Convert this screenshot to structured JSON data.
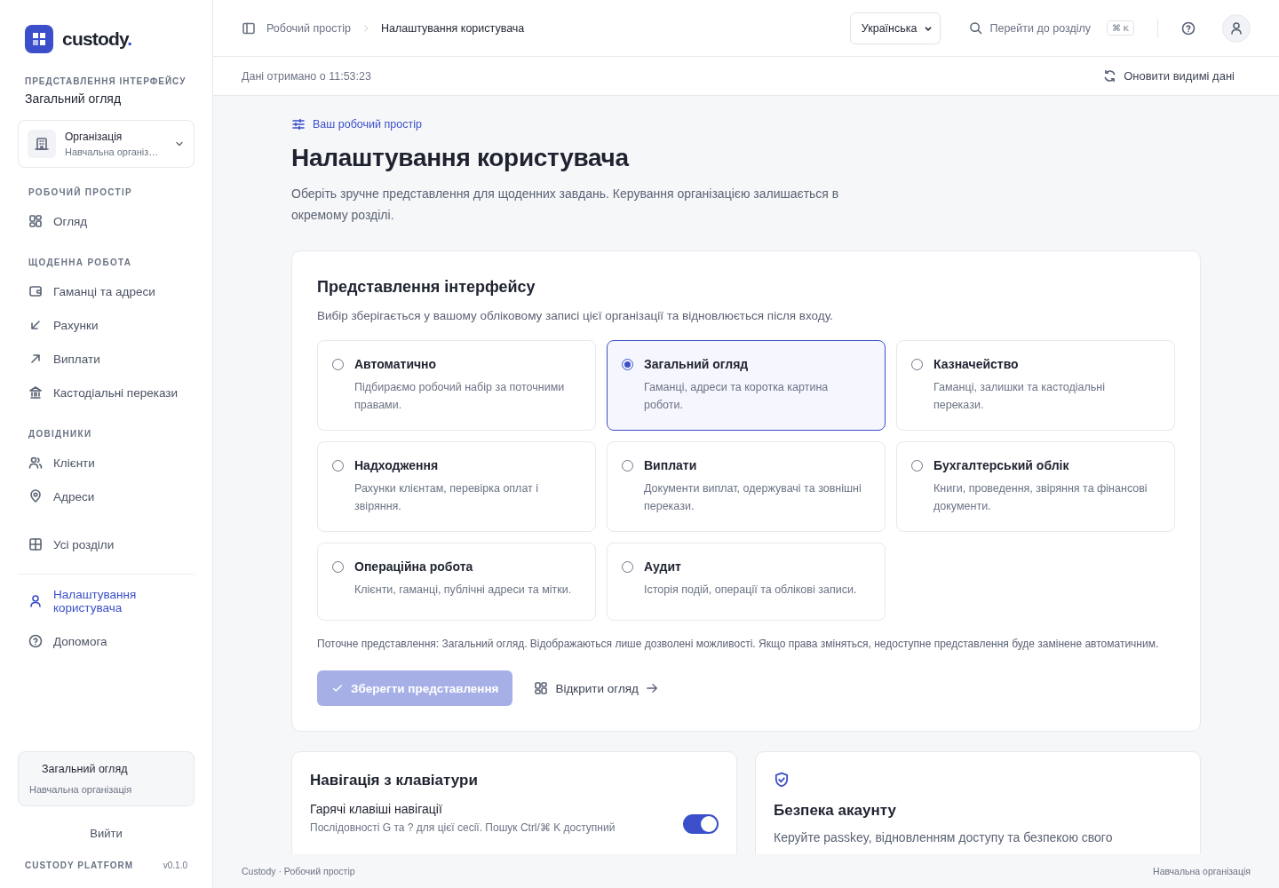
{
  "brand": {
    "name": "custody",
    "mark": "."
  },
  "sidebar": {
    "view_label": "ПРЕДСТАВЛЕННЯ ІНТЕРФЕЙСУ",
    "view_value": "Загальний огляд",
    "org": {
      "title": "Організація",
      "subtitle": "Навчальна організ…"
    },
    "sections": [
      {
        "heading": "РОБОЧИЙ ПРОСТІР",
        "items": [
          {
            "kind": "grid",
            "label": "Огляд",
            "selected": false
          }
        ]
      },
      {
        "heading": "ЩОДЕННА РОБОТА",
        "items": [
          {
            "kind": "wallet",
            "label": "Гаманці та адреси",
            "selected": false
          },
          {
            "kind": "arrow-in",
            "label": "Рахунки",
            "selected": false
          },
          {
            "kind": "arrow-out",
            "label": "Виплати",
            "selected": false
          },
          {
            "kind": "bank",
            "label": "Кастодіальні перекази",
            "selected": false
          }
        ]
      },
      {
        "heading": "ДОВІДНИКИ",
        "items": [
          {
            "kind": "users",
            "label": "Клієнти",
            "selected": false
          },
          {
            "kind": "pin",
            "label": "Адреси",
            "selected": false
          }
        ]
      },
      {
        "items": [
          {
            "kind": "table",
            "label": "Усі розділи",
            "selected": false
          }
        ]
      }
    ],
    "bottom_items": [
      {
        "kind": "user",
        "label": "Налаштування користувача",
        "selected": true
      },
      {
        "kind": "help",
        "label": "Допомога",
        "selected": false
      }
    ],
    "context": {
      "title": "Загальний огляд",
      "subtitle": "Навчальна організація"
    },
    "logout": "Вийти",
    "platform": "CUSTODY PLATFORM",
    "version": "v0.1.0"
  },
  "header": {
    "breadcrumb": [
      "Робочий простір",
      "Налаштування користувача"
    ],
    "language": "Українська",
    "search": "Перейти до розділу",
    "shortcut": "⌘ K"
  },
  "info_bar": {
    "fetched": "Дані отримано о 11:53:23",
    "refresh": "Оновити видимі дані"
  },
  "page": {
    "eyebrow": "Ваш робочий простір",
    "title": "Налаштування користувача",
    "description": "Оберіть зручне представлення для щоденних завдань. Керування організацією залишається в окремому розділі."
  },
  "view_panel": {
    "title": "Представлення інтерфейсу",
    "subtitle": "Вибір зберігається у вашому обліковому записі цієї організації та відновлюється після входу.",
    "options": [
      {
        "title": "Автоматично",
        "description": "Підбираємо робочий набір за поточними правами.",
        "selected": false
      },
      {
        "title": "Загальний огляд",
        "description": "Гаманці, адреси та коротка картина роботи.",
        "selected": true
      },
      {
        "title": "Казначейство",
        "description": "Гаманці, залишки та кастодіальні перекази.",
        "selected": false
      },
      {
        "title": "Надходження",
        "description": "Рахунки клієнтам, перевірка оплат і звіряння.",
        "selected": false
      },
      {
        "title": "Виплати",
        "description": "Документи виплат, одержувачі та зовнішні перекази.",
        "selected": false
      },
      {
        "title": "Бухгалтерський облік",
        "description": "Книги, проведення, звіряння та фінансові документи.",
        "selected": false
      },
      {
        "title": "Операційна робота",
        "description": "Клієнти, гаманці, публічні адреси та мітки.",
        "selected": false
      },
      {
        "title": "Аудит",
        "description": "Історія подій, операції та облікові записи.",
        "selected": false
      }
    ],
    "note": "Поточне представлення: Загальний огляд. Відображаються лише дозволені можливості. Якщо права зміняться, недоступне представлення буде замінене автоматичним.",
    "save": {
      "label": "Зберегти представлення",
      "disabled": true
    },
    "open_link": "Відкрити огляд"
  },
  "keyboard_card": {
    "title": "Навігація з клавіатури",
    "setting": {
      "label": "Гарячі клавіші навігації",
      "description": "Послідовності G та ? для цієї сесії. Пошук Ctrl/⌘ K доступний",
      "on": true
    }
  },
  "security_card": {
    "title": "Безпека акаунту",
    "description": "Керуйте passkey, відновленням доступу та безпекою свого"
  },
  "footer": {
    "left": "Custody · Робочий простір",
    "right": "Навчальна організація"
  }
}
